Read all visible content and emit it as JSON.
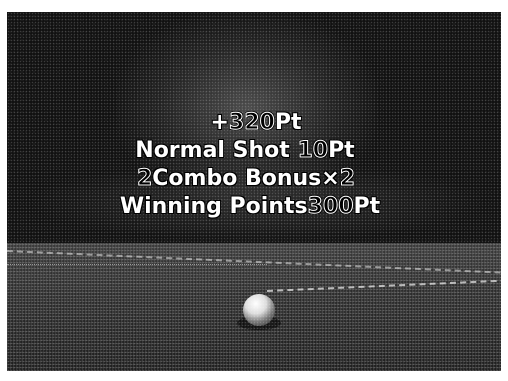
{
  "score_popup": {
    "total_prefix": "+",
    "total_value": "320",
    "total_unit": "Pt",
    "normal_shot_label": "Normal Shot",
    "normal_shot_value": "10",
    "normal_shot_unit": "Pt",
    "combo_count": "2",
    "combo_label": "Combo Bonus",
    "combo_multiplier_sign": "×",
    "combo_multiplier_value": "2",
    "winning_label": "Winning Points",
    "winning_value": "300",
    "winning_unit": "Pt"
  }
}
